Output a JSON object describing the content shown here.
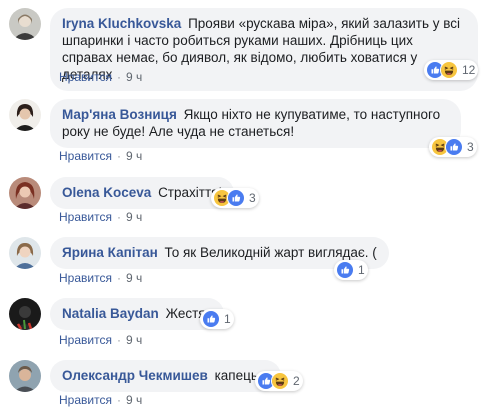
{
  "comments": [
    {
      "author": "Iryna Kluchkovska",
      "text": "Прояви «рускава міра», який залазить у всі шпаринки і часто робиться руками наших. Дрібниць цих справах немає, бо диявол, як відомо, любить ховатися у деталях",
      "reactions": [
        "like",
        "haha"
      ],
      "reaction_count": "12",
      "like_label": "Нравится",
      "separator": "·",
      "time": "9 ч"
    },
    {
      "author": "Мар'яна Возниця",
      "text": "Якщо ніхто не купуватиме, то наступного року не буде! Але чуда не станеться!",
      "reactions": [
        "haha",
        "like"
      ],
      "reaction_count": "3",
      "like_label": "Нравится",
      "separator": "·",
      "time": "9 ч"
    },
    {
      "author": "Olena Koceva",
      "text": "Страхіття!",
      "reactions": [
        "haha",
        "like"
      ],
      "reaction_count": "3",
      "like_label": "Нравится",
      "separator": "·",
      "time": "9 ч"
    },
    {
      "author": "Ярина Капітан",
      "text": "То як Великодній жарт виглядає. (",
      "reactions": [
        "like"
      ],
      "reaction_count": "1",
      "like_label": "Нравится",
      "separator": "·",
      "time": "9 ч"
    },
    {
      "author": "Natalia Baydan",
      "text": "Жестяк",
      "reactions": [
        "like"
      ],
      "reaction_count": "1",
      "like_label": "Нравится",
      "separator": "·",
      "time": "9 ч"
    },
    {
      "author": "Олександр Чекмишев",
      "text": "капець...",
      "reactions": [
        "like",
        "haha"
      ],
      "reaction_count": "2",
      "like_label": "Нравится",
      "separator": "·",
      "time": "9 ч"
    }
  ],
  "colors": {
    "author": "#385898",
    "bubble": "#f2f3f5",
    "like_reaction": "#4a7cf0",
    "haha_reaction": "#f7c53f",
    "meta_text": "#606770"
  },
  "icons": {
    "like": "thumbs-up-reaction-icon",
    "haha": "laughing-face-reaction-icon"
  }
}
